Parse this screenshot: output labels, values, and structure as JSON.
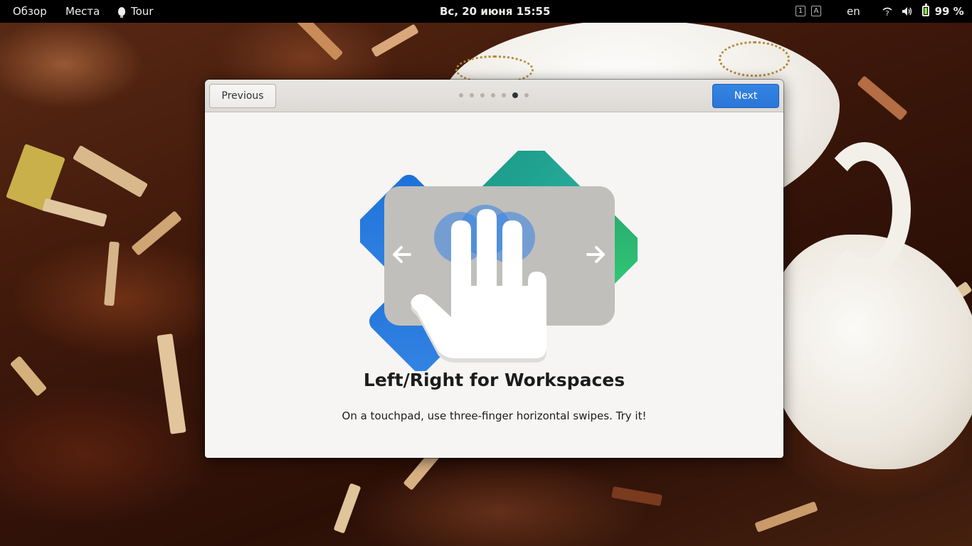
{
  "topbar": {
    "activities": "Обзор",
    "places": "Места",
    "app_name": "Tour",
    "clock": "Вс, 20 июня  15:55",
    "kbd_indicator_1": "1",
    "kbd_indicator_2": "A",
    "language": "en",
    "network_icon": "?",
    "battery_percent": "99 %"
  },
  "tour": {
    "previous_label": "Previous",
    "next_label": "Next",
    "page_count": 7,
    "current_page": 6,
    "title": "Left/Right for Workspaces",
    "description": "On a touchpad, use three-finger horizontal swipes. Try it!"
  },
  "colors": {
    "accent": "#3584e4",
    "window_bg": "#f6f5f4",
    "headerbar_bg": "#dfdcd8",
    "workspace_green": "#2ec27e",
    "workspace_teal": "#26a69a",
    "workspace_blue": "#1c71d8",
    "touchpad_gray": "#c0bfbc"
  },
  "icons": [
    "lightbulb-icon",
    "network-icon",
    "volume-icon",
    "battery-icon",
    "arrow-left-icon",
    "arrow-right-icon",
    "hand-icon"
  ]
}
